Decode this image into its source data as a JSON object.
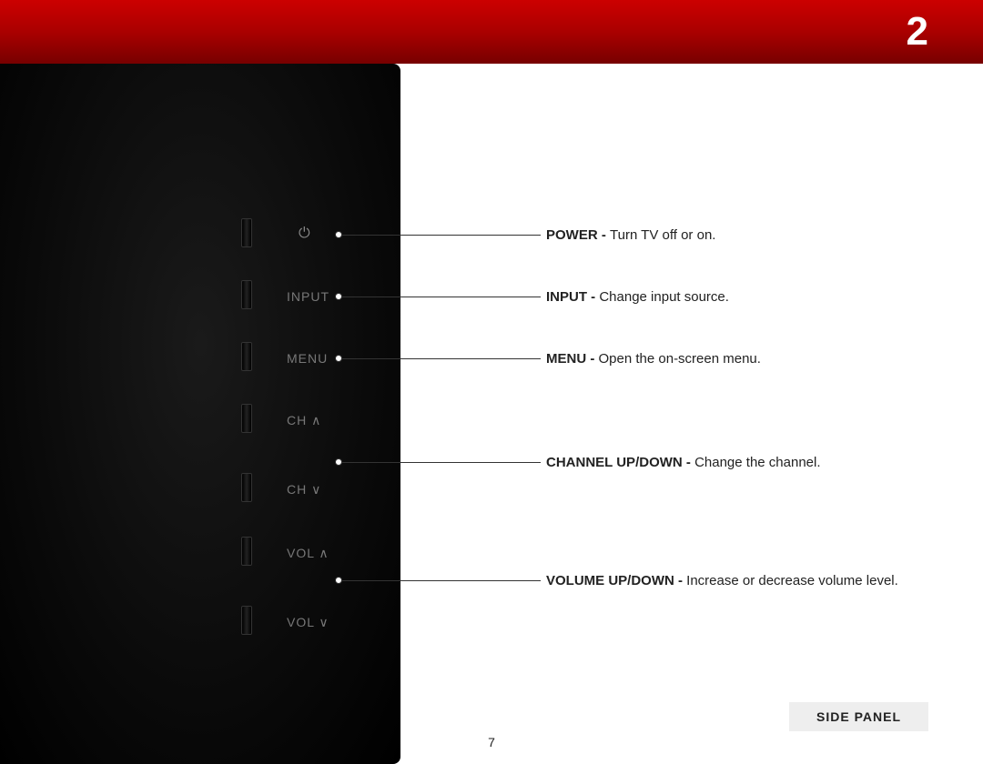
{
  "header": {
    "chapter_number": "2"
  },
  "panel": {
    "buttons": {
      "power_icon": "⏻",
      "input": "INPUT",
      "menu": "MENU",
      "ch_up": "CH ∧",
      "ch_down": "CH ∨",
      "vol_up": "VOL ∧",
      "vol_down": "VOL ∨"
    }
  },
  "callouts": {
    "power": {
      "label": "POWER - ",
      "desc": "Turn TV off or on."
    },
    "input": {
      "label": "INPUT - ",
      "desc": "Change input source."
    },
    "menu": {
      "label": "MENU - ",
      "desc": "Open the on-screen menu."
    },
    "channel": {
      "label": "CHANNEL UP/DOWN - ",
      "desc": "Change the channel."
    },
    "volume": {
      "label": "VOLUME UP/DOWN - ",
      "desc": "Increase or decrease volume level."
    }
  },
  "footer": {
    "section_label": "SIDE PANEL",
    "page_number": "7"
  }
}
